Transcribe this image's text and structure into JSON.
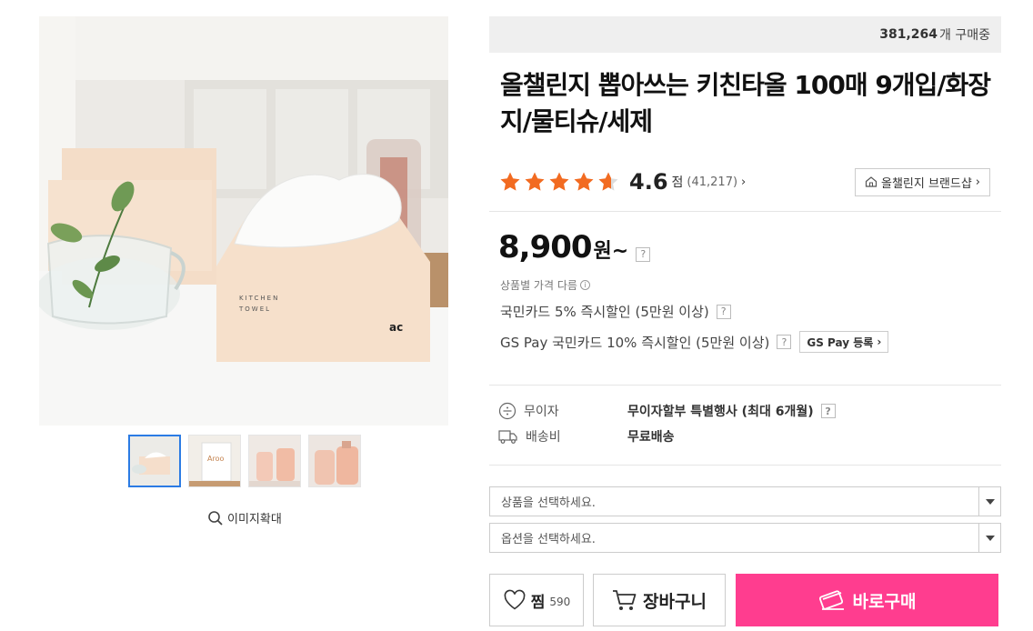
{
  "gallery": {
    "main_image_alt": "kitchen towel product photo",
    "packaging_text_line1": "KITCHEN",
    "packaging_text_line2": "TOWEL",
    "packaging_logo": "ac",
    "thumbnail2_brand": "Aroo",
    "zoom_label": "이미지확대"
  },
  "header": {
    "buyer_count": "381,264",
    "buyer_suffix": "개 구매중",
    "title": "올챌린지 뽑아쓰는 키친타올 100매 9개입/화장지/물티슈/세제"
  },
  "rating": {
    "stars": 4.6,
    "score": "4.6",
    "score_unit": "점",
    "review_count": "(41,217)",
    "brand_shop_label": "올챌린지 브랜드샵",
    "star_color": "#f26b21"
  },
  "price": {
    "amount": "8,900",
    "unit": "원~",
    "note": "상품별 가격 다름",
    "discount1": "국민카드 5% 즉시할인 (5만원 이상)",
    "discount2": "GS Pay 국민카드 10% 즉시할인 (5만원 이상)",
    "gspay_button": "GS Pay 등록",
    "help_mark": "?",
    "info_mark": "i"
  },
  "benefits": {
    "installment_label": "무이자",
    "installment_value": "무이자할부 특별행사 (최대 6개월)",
    "shipping_label": "배송비",
    "shipping_value": "무료배송"
  },
  "options": {
    "product_select": "상품을 선택하세요.",
    "option_select": "옵션을 선택하세요."
  },
  "actions": {
    "wish_label": "찜",
    "wish_count": "590",
    "cart_label": "장바구니",
    "buy_label": "바로구매",
    "buy_color": "#ff3d8f"
  }
}
